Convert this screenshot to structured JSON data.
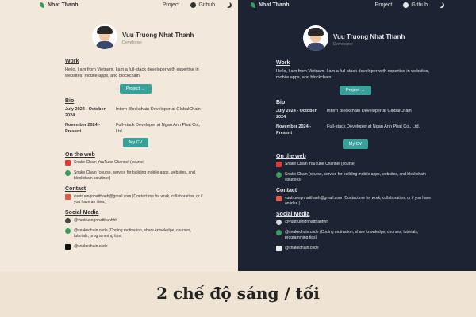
{
  "caption": "2 chế độ sáng / tối",
  "nav": {
    "brand": "Nhat Thanh",
    "links": {
      "project": "Project",
      "github": "Github"
    }
  },
  "profile": {
    "name": "Vuu Truong Nhat Thanh",
    "role": "Developer"
  },
  "work": {
    "title": "Work",
    "text": "Hello, I am from Vietnam. I am a full-stack developer with expertise in websites, mobile apps, and blockchain.",
    "button": "Project →"
  },
  "bio": {
    "title": "Bio",
    "items": [
      {
        "date": "July 2024 - October 2024",
        "text": "Intern Blockchain Developer at GlobalChain"
      },
      {
        "date": "November 2024 - Present",
        "text": "Full-stack Developer at Ngan Anh Phat Co., Ltd."
      }
    ],
    "button": "My CV"
  },
  "web": {
    "title": "On the web",
    "items": [
      {
        "icon": "youtube-icon",
        "text": "Snake Chain YouTube Channel (course)"
      },
      {
        "icon": "snake-icon",
        "text": "Snake Chain (course, service for building mobile apps, websites, and blockchain solutions)"
      }
    ]
  },
  "contact": {
    "title": "Contact",
    "text": "vuutruongnhatthanh@gmail.com (Contact me for work, collaboration, or if you have an idea.)"
  },
  "social": {
    "title": "Social Media",
    "items": [
      {
        "icon": "github-icon",
        "text": "@vuutruongnhatthanhhh"
      },
      {
        "icon": "snake-icon",
        "text": "@snakechain.code (Coding motivation, share knowledge, courses, tutorials, programming tips)"
      },
      {
        "icon": "tiktok-icon",
        "text": "@snakechain.code"
      }
    ]
  }
}
